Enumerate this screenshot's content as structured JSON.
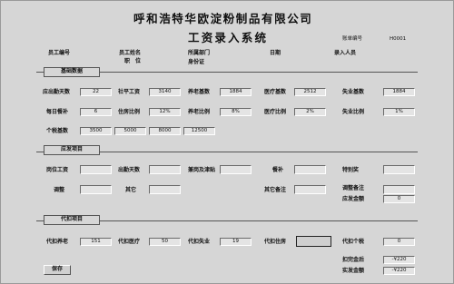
{
  "company": "呼和浩特华欧淀粉制品有限公司",
  "form_title": "工资录入系统",
  "header": {
    "account_no_label": "账单编号",
    "account_no": "H0001",
    "emp_no_label": "员工编号",
    "emp_name_label": "员工姓名",
    "dept_label": "所属部门",
    "date_label": "日期",
    "entry_person_label": "录入人员",
    "position_label": "职　位",
    "id_card_label": "身份证"
  },
  "sections": {
    "basic": "基础数据",
    "payable": "应发项目",
    "deduct": "代扣项目"
  },
  "basic": {
    "row1": [
      {
        "label": "应出勤天数",
        "value": "22"
      },
      {
        "label": "社平工资",
        "value": "3140"
      },
      {
        "label": "养老基数",
        "value": "1884"
      },
      {
        "label": "医疗基数",
        "value": "2512"
      },
      {
        "label": "失业基数",
        "value": "1884"
      }
    ],
    "row2": [
      {
        "label": "每日餐补",
        "value": "6"
      },
      {
        "label": "住房比例",
        "value": "12%"
      },
      {
        "label": "养老比例",
        "value": "8%"
      },
      {
        "label": "医疗比例",
        "value": "2%"
      },
      {
        "label": "失业比例",
        "value": "1%"
      }
    ],
    "tax_label": "个税基数",
    "tax_values": [
      "3500",
      "5000",
      "8000",
      "12500"
    ]
  },
  "payable": {
    "row1_labels": [
      "岗位工资",
      "出勤天数",
      "兼岗及津贴",
      "餐补",
      "特别奖"
    ],
    "row2_labels": [
      "调整",
      "其它",
      "其它备注",
      "调整备注",
      "应发金额"
    ],
    "gross_value": "0"
  },
  "deduct": {
    "items": [
      {
        "label": "代扣养老",
        "value": "151"
      },
      {
        "label": "代扣医疗",
        "value": "50"
      },
      {
        "label": "代扣失业",
        "value": "19"
      },
      {
        "label": "代扣住房",
        "value": ""
      },
      {
        "label": "代扣个税",
        "value": "0"
      }
    ],
    "after_deduct_label": "扣完金后",
    "after_deduct_value": "-¥220",
    "net_label": "实发金额",
    "net_value": "-¥220"
  },
  "save_label": "保存"
}
